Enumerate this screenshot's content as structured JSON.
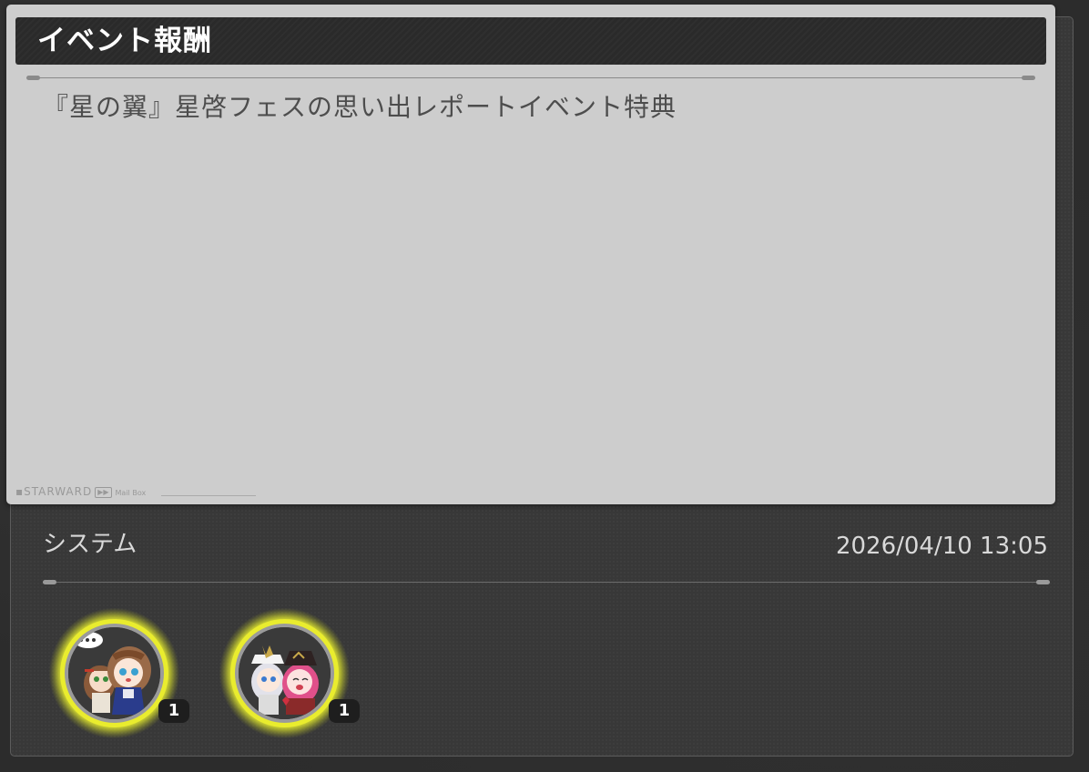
{
  "mail": {
    "title": "イベント報酬",
    "subject": "『星の翼』星啓フェスの思い出レポートイベント特典",
    "footer": {
      "brand": "STARWARD",
      "ff_glyph": "▶▶",
      "mailbox": "Mail Box"
    },
    "sender": "システム",
    "timestamp": "2026/04/10 13:05"
  },
  "rewards": [
    {
      "icon": "chibi-character-pair-icon",
      "quantity": "1"
    },
    {
      "icon": "chibi-character-pair-icon",
      "quantity": "1"
    }
  ],
  "colors": {
    "card_bg": "#cdcdcd",
    "header_bg": "#2a2a2a",
    "panel_bg": "#383838",
    "reward_glow": "#e9ec2e"
  }
}
